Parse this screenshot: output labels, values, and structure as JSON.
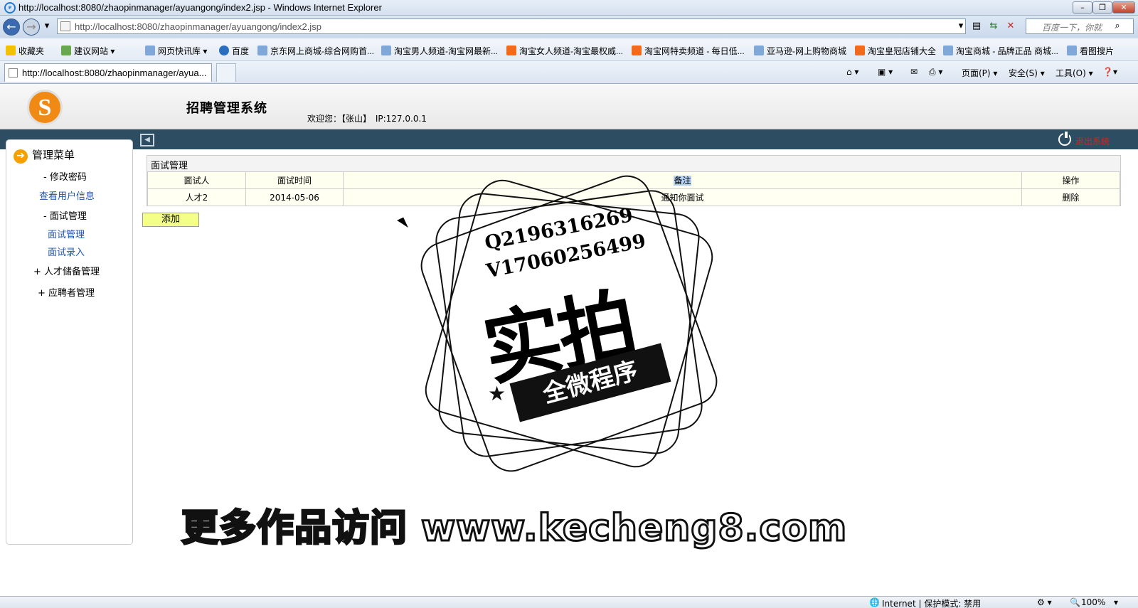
{
  "window": {
    "title": "http://localhost:8080/zhaopinmanager/ayuangong/index2.jsp - Windows Internet Explorer",
    "min": "–",
    "max": "❐",
    "close": "✕"
  },
  "address": {
    "url": "http://localhost:8080/zhaopinmanager/ayuangong/index2.jsp",
    "search_placeholder": "百度一下，你就"
  },
  "favorites": {
    "label": "收藏夹",
    "items": [
      "建议网站 ▾",
      "网页快讯库 ▾",
      "百度",
      "京东网上商城-综合网购首...",
      "淘宝男人频道-淘宝网最新...",
      "淘宝女人频道-淘宝最权威...",
      "淘宝网特卖频道 - 每日低...",
      "亚马逊-网上购物商城",
      "淘宝皇冠店铺大全",
      "淘宝商城 - 品牌正品 商城...",
      "看图搜片"
    ]
  },
  "tab": {
    "title": "http://localhost:8080/zhaopinmanager/ayua..."
  },
  "commands": {
    "page": "页面(P) ▾",
    "safety": "安全(S) ▾",
    "tools": "工具(O) ▾"
  },
  "header": {
    "system_title": "招聘管理系统",
    "welcome": "欢迎您：【张山】",
    "ip": "IP:127.0.0.1",
    "logout": "退出系统"
  },
  "sidebar": {
    "menu_title": "管理菜单",
    "items": [
      {
        "label": "- 修改密码"
      },
      {
        "label": "查看用户信息"
      },
      {
        "label": "- 面试管理"
      },
      {
        "label": "面试管理"
      },
      {
        "label": "面试录入"
      },
      {
        "label": "+ 人才储备管理"
      },
      {
        "label": "+ 应聘者管理"
      }
    ]
  },
  "main": {
    "panel_title": "面试管理",
    "columns": [
      "面试人",
      "面试时间",
      "备注",
      "操作"
    ],
    "rows": [
      {
        "name": "人才2",
        "date": "2014-05-06",
        "remark": "通知你面试",
        "action": "删除"
      }
    ],
    "add_button": "添加"
  },
  "watermark": {
    "q": "Q2196316269",
    "v": "V17060256499",
    "big": "实拍",
    "ribbon": "全微程序",
    "site": "更多作品访问 www.kecheng8.com"
  },
  "status": {
    "zone": "Internet | 保护模式: 禁用",
    "zoom": "100%"
  },
  "colors": {
    "navbar": "#2d4d63",
    "add_button": "#f4ff88",
    "logo": "#f08a14",
    "link": "#2255aa"
  }
}
